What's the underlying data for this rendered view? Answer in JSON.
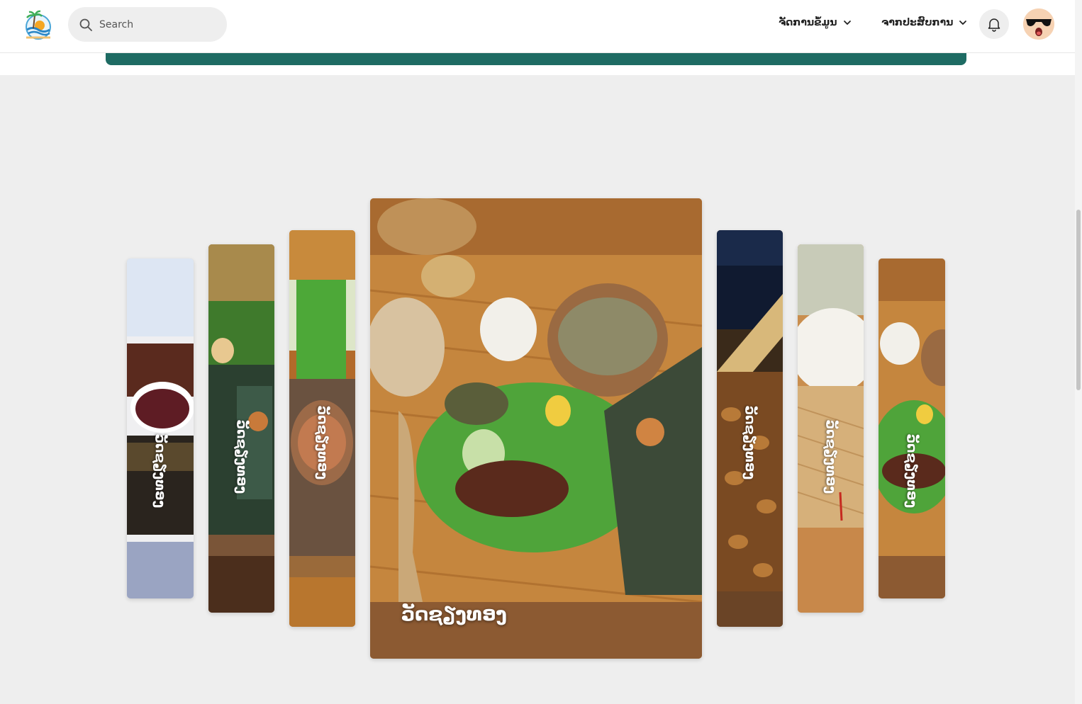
{
  "header": {
    "logo": "beach-logo-icon",
    "search": {
      "placeholder": "Search",
      "icon": "search-icon"
    },
    "menus": [
      {
        "label": "ຈັດການຂໍ້ມູນ",
        "icon": "chevron-down-icon"
      },
      {
        "label": "ຈາກປະສົບການ",
        "icon": "chevron-down-icon"
      }
    ],
    "notifications_icon": "bell-icon",
    "avatar_icon": "avatar-sunglasses-icon",
    "accent_color": "#1e6b63"
  },
  "gallery": {
    "cards": [
      {
        "label": "ວັດຊຽງທອງ",
        "active": false
      },
      {
        "label": "ວັດຊຽງທອງ",
        "active": false
      },
      {
        "label": "ວັດຊຽງທອງ",
        "active": false
      },
      {
        "label": "ວັດຊຽງທອງ",
        "active": true
      },
      {
        "label": "ວັດຊຽງທອງ",
        "active": false
      },
      {
        "label": "ວັດຊຽງທອງ",
        "active": false
      },
      {
        "label": "ວັດຊຽງທອງ",
        "active": false
      }
    ]
  }
}
